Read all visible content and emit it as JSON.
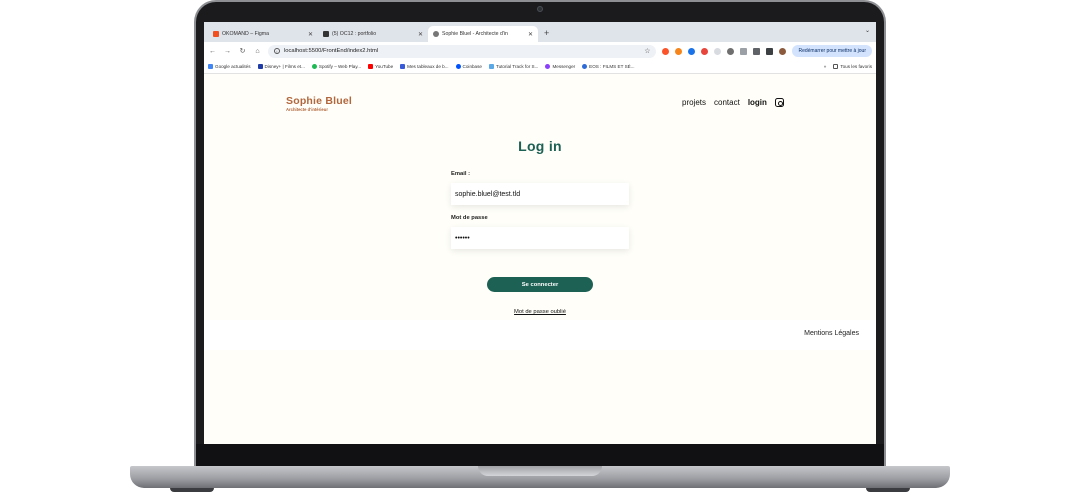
{
  "browser": {
    "tabs": [
      {
        "title": "OKOMAND – Figma",
        "color": "#f24e1e"
      },
      {
        "title": "(5) OC12 : portfolio",
        "color": "#333333"
      },
      {
        "title": "Sophie Bluel - Architecte d'in",
        "color": "#555555"
      }
    ],
    "new_tab": "+",
    "tab_menu": "⌄",
    "url": "localhost:5500/FrontEnd/index2.html",
    "restart_label": "Redémarrer pour mettre à jour",
    "nav": {
      "back": "←",
      "forward": "→",
      "reload": "↻",
      "home": "⌂"
    },
    "bookmarks": [
      {
        "label": "Google actualités",
        "color": "#4285f4"
      },
      {
        "label": "Disney+ | Films et...",
        "color": "#1f3ba6"
      },
      {
        "label": "Spotify – Web Play...",
        "color": "#1db954"
      },
      {
        "label": "YouTube",
        "color": "#ff0000"
      },
      {
        "label": "Mes tableaux de b...",
        "color": "#3a5bd9"
      },
      {
        "label": "Coinbase",
        "color": "#0052ff"
      },
      {
        "label": "Tutorial Track for S...",
        "color": "#5aa9e6"
      },
      {
        "label": "Messenger",
        "color": "#8a3ffc"
      },
      {
        "label": "EOS : FILMS ET SÉ...",
        "color": "#2d6bd8"
      }
    ],
    "bookmarks_more": "»",
    "all_favorites": "Tous les favoris"
  },
  "site": {
    "logo_title": "Sophie Bluel",
    "logo_subtitle": "Architecte d'intérieur",
    "nav": {
      "projets": "projets",
      "contact": "contact",
      "login": "login"
    }
  },
  "login": {
    "title": "Log in",
    "email_label": "Email :",
    "email_value": "sophie.bluel@test.tld",
    "password_label": "Mot de passe",
    "password_value": "••••••",
    "submit_label": "Se connecter",
    "forgot_label": "Mot de passe oublié"
  },
  "footer": {
    "legal": "Mentions Légales"
  },
  "colors": {
    "accent": "#1d6154",
    "logo": "#b1663c",
    "background": "#fffef8"
  }
}
